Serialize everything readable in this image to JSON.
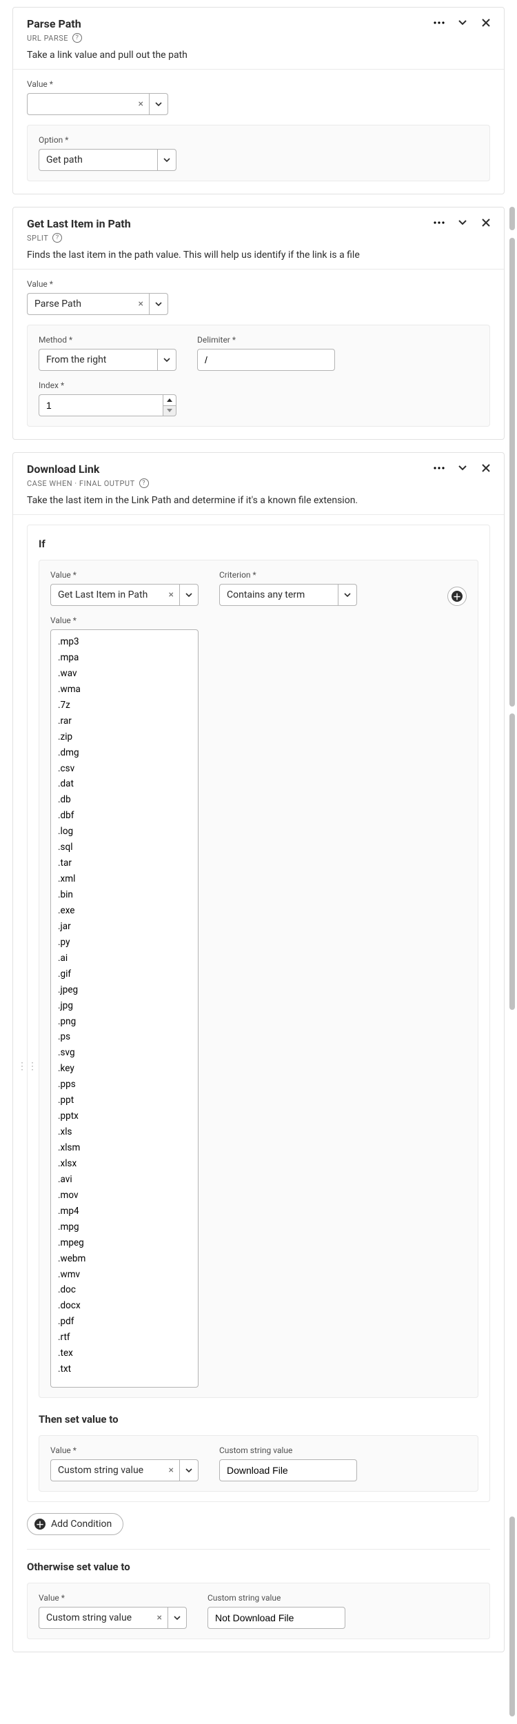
{
  "labels": {
    "value": "Value",
    "option": "Option",
    "method": "Method",
    "delimiter": "Delimiter",
    "index": "Index",
    "criterion": "Criterion",
    "custom_string_value": "Custom string value"
  },
  "card1": {
    "title": "Parse Path",
    "subtitle": "URL PARSE",
    "desc": "Take a link value and pull out the path",
    "value_input": "",
    "option_select": "Get path"
  },
  "card2": {
    "title": "Get Last Item in Path",
    "subtitle": "SPLIT",
    "desc": "Finds the last item in the path value. This will help us identify if the link is a file",
    "value_select": "Parse Path",
    "method_select": "From the right",
    "delimiter_value": "/",
    "index_value": "1"
  },
  "card3": {
    "title": "Download Link",
    "subtitle": "CASE WHEN · FINAL OUTPUT",
    "desc": "Take the last item in the Link Path and determine if it's a known file extension.",
    "if_label": "If",
    "value_select": "Get Last Item in Path",
    "criterion_select": "Contains any term",
    "terms_textarea": ".mp3\n.mpa\n.wav\n.wma\n.7z\n.rar\n.zip\n.dmg\n.csv\n.dat\n.db\n.dbf\n.log\n.sql\n.tar\n.xml\n.bin\n.exe\n.jar\n.py\n.ai\n.gif\n.jpeg\n.jpg\n.png\n.ps\n.svg\n.key\n.pps\n.ppt\n.pptx\n.xls\n.xlsm\n.xlsx\n.avi\n.mov\n.mp4\n.mpg\n.mpeg\n.webm\n.wmv\n.doc\n.docx\n.pdf\n.rtf\n.tex\n.txt",
    "then_label": "Then set value to",
    "then_value_select": "Custom string value",
    "then_custom_value": "Download File",
    "add_condition": "Add Condition",
    "otherwise_label": "Otherwise set value to",
    "otherwise_value_select": "Custom string value",
    "otherwise_custom_value": "Not Download File"
  }
}
